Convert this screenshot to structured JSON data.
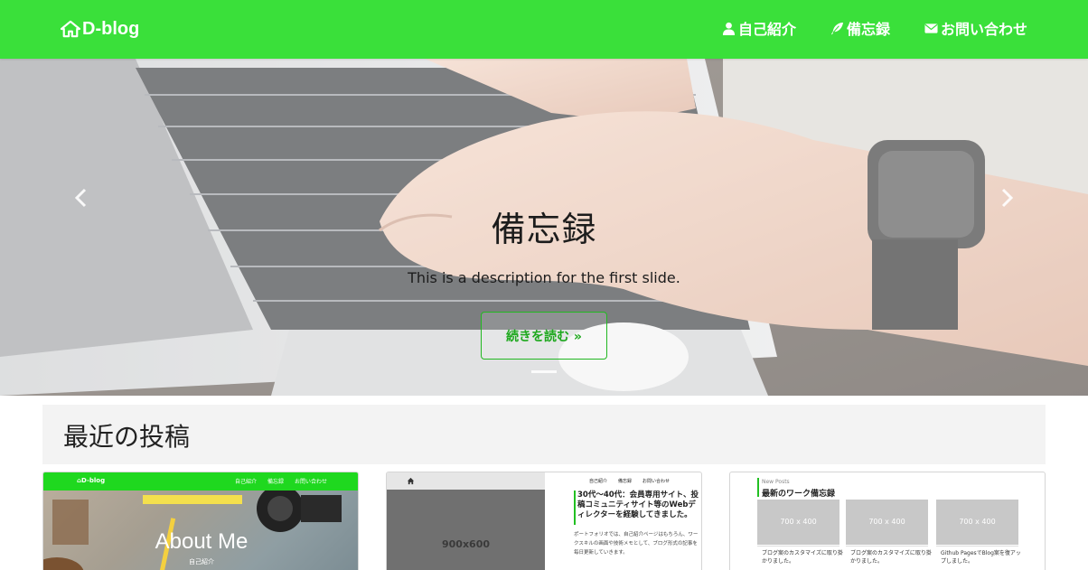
{
  "navbar": {
    "brand": "D-blog",
    "links": [
      {
        "label": "自己紹介",
        "icon": "user-icon"
      },
      {
        "label": "備忘録",
        "icon": "feather-icon"
      },
      {
        "label": "お問い合わせ",
        "icon": "envelope-icon"
      }
    ],
    "color": "#3ae03a"
  },
  "hero": {
    "title": "備忘録",
    "description": "This is a description for the first slide.",
    "button_label": "続きを読む »",
    "accent": "#1da81d"
  },
  "recent": {
    "title": "最近の投稿",
    "cards": [
      {
        "nav_brand": "D-blog",
        "nav_links": [
          "自己紹介",
          "備忘録",
          "お問い合わせ"
        ],
        "title": "About Me",
        "subtitle": "自己紹介"
      },
      {
        "placeholder": "900x600",
        "nav_links": [
          "自己紹介",
          "備忘録",
          "お問い合わせ"
        ],
        "heading": "30代～40代：会員専用サイト、投稿コミュニティサイト等のWebディレクターを経験してきました。",
        "body": "ポートフォリオでは、自己紹介ページはもちろん、ワークスキルの画面や技術メモとして、ブログ形式の記事を毎日更新していきます。"
      },
      {
        "small_label": "New Posts",
        "heading": "最新のワーク備忘録",
        "tiles": [
          {
            "placeholder": "700 x 400",
            "caption": "ブログ案のカスタマイズに取り掛かりました。"
          },
          {
            "placeholder": "700 x 400",
            "caption": "ブログ案のカスタマイズに取り掛かりました。"
          },
          {
            "placeholder": "700 x 400",
            "caption": "Github PagesでBlog案を復アップしました。"
          }
        ]
      }
    ]
  }
}
